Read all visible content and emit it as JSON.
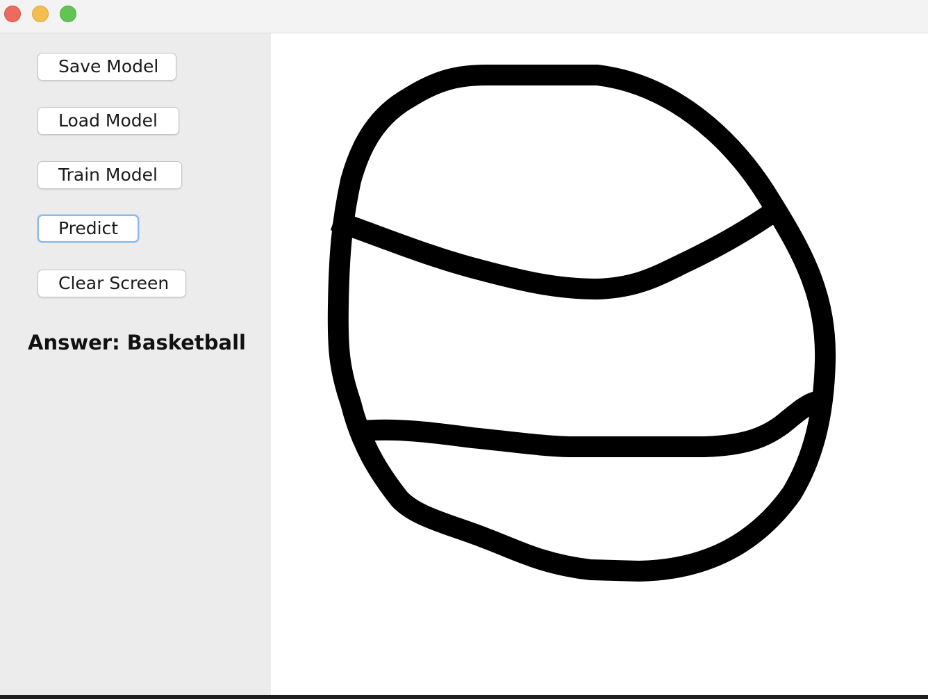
{
  "window": {
    "controls": {
      "close_icon": "close-icon",
      "minimize_icon": "minimize-icon",
      "zoom_icon": "zoom-icon",
      "colors": {
        "close": "#ec6a5e",
        "minimize": "#f4be4f",
        "zoom": "#61c554"
      }
    }
  },
  "sidebar": {
    "buttons": {
      "save": "Save Model",
      "load": "Load Model",
      "train": "Train Model",
      "predict": "Predict",
      "clear": "Clear Screen"
    },
    "answer": "Answer: Basketball"
  },
  "canvas": {
    "content": "hand-drawn black strokes",
    "stroke_color": "#000000",
    "background_color": "#ffffff"
  }
}
